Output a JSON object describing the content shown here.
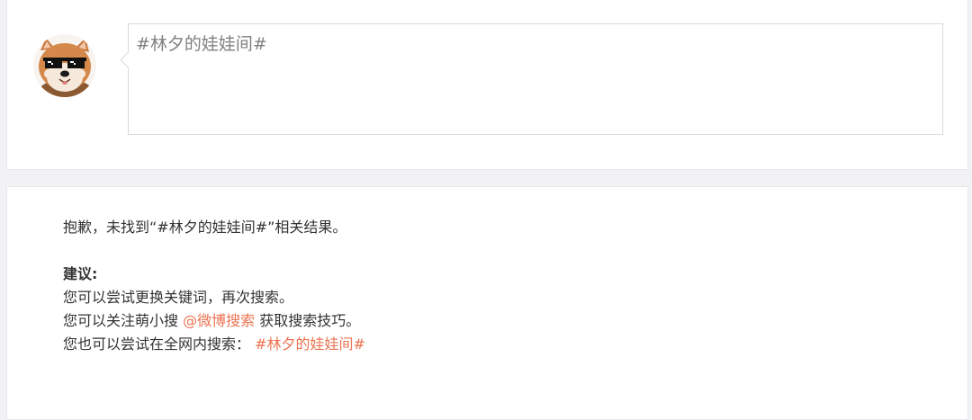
{
  "composer": {
    "text": "#林夕的娃娃间#"
  },
  "result": {
    "sorry_prefix": "抱歉，未找到“",
    "sorry_query": "#林夕的娃娃间#",
    "sorry_suffix": "”相关结果。",
    "suggest_title": "建议:",
    "tip_change_keyword": "您可以尝试更换关键词，再次搜索。",
    "tip_follow_prefix": "您可以关注萌小搜",
    "tip_follow_link": "@微博搜索",
    "tip_follow_suffix": "获取搜索技巧。",
    "tip_web_search_prefix": "您也可以尝试在全网内搜索：",
    "tip_web_search_link": "#林夕的娃娃间#"
  },
  "colors": {
    "link": "#eb7350",
    "text": "#333333",
    "placeholder": "#808080"
  },
  "icons": {
    "avatar": "shiba-dog-with-pixel-sunglasses"
  }
}
